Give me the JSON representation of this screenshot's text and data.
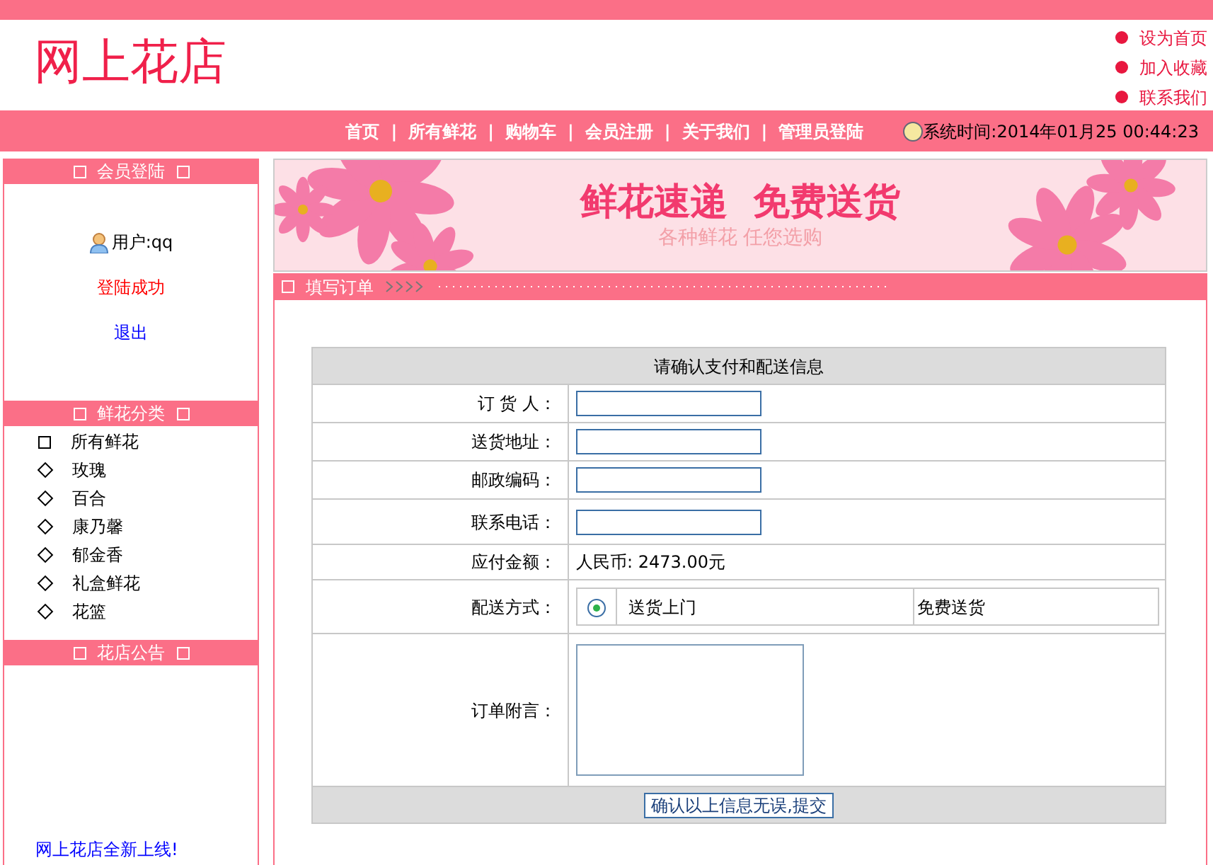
{
  "top_links": [
    "设为首页",
    "加入收藏",
    "联系我们"
  ],
  "site_title": "网上花店",
  "nav": {
    "items": [
      "首页",
      "所有鲜花",
      "购物车",
      "会员注册",
      "关于我们",
      "管理员登陆"
    ],
    "separator": "|",
    "system_time": "系统时间:2014年01月25 00:44:23"
  },
  "sidebar": {
    "login": {
      "title": "会员登陆",
      "user_label": "用户:qq",
      "status": "登陆成功",
      "logout": "退出"
    },
    "categories": {
      "title": "鲜花分类",
      "items": [
        {
          "label": "所有鲜花",
          "selected": true
        },
        {
          "label": "玫瑰",
          "selected": false
        },
        {
          "label": "百合",
          "selected": false
        },
        {
          "label": "康乃馨",
          "selected": false
        },
        {
          "label": "郁金香",
          "selected": false
        },
        {
          "label": "礼盒鲜花",
          "selected": false
        },
        {
          "label": "花篮",
          "selected": false
        }
      ]
    },
    "notice": {
      "title": "花店公告",
      "items": [
        "网上花店全新上线!"
      ]
    }
  },
  "banner": {
    "headline": "鲜花速递  免费送货",
    "subline": "各种鲜花 任您选购"
  },
  "order": {
    "section_title": "填写订单",
    "table_title": "请确认支付和配送信息",
    "rows": [
      {
        "kind": "input",
        "label": "订 货 人："
      },
      {
        "kind": "input",
        "label": "送货地址："
      },
      {
        "kind": "input",
        "label": "邮政编码："
      },
      {
        "kind": "input",
        "label": "联系电话："
      },
      {
        "kind": "text",
        "label": "应付金额：",
        "value": "人民币: 2473.00元"
      },
      {
        "kind": "radio",
        "label": "配送方式：",
        "options": [
          {
            "label": "送货上门",
            "note": "免费送货",
            "selected": true
          }
        ]
      },
      {
        "kind": "textarea",
        "label": "订单附言："
      }
    ],
    "submit": "确认以上信息无误,提交"
  }
}
